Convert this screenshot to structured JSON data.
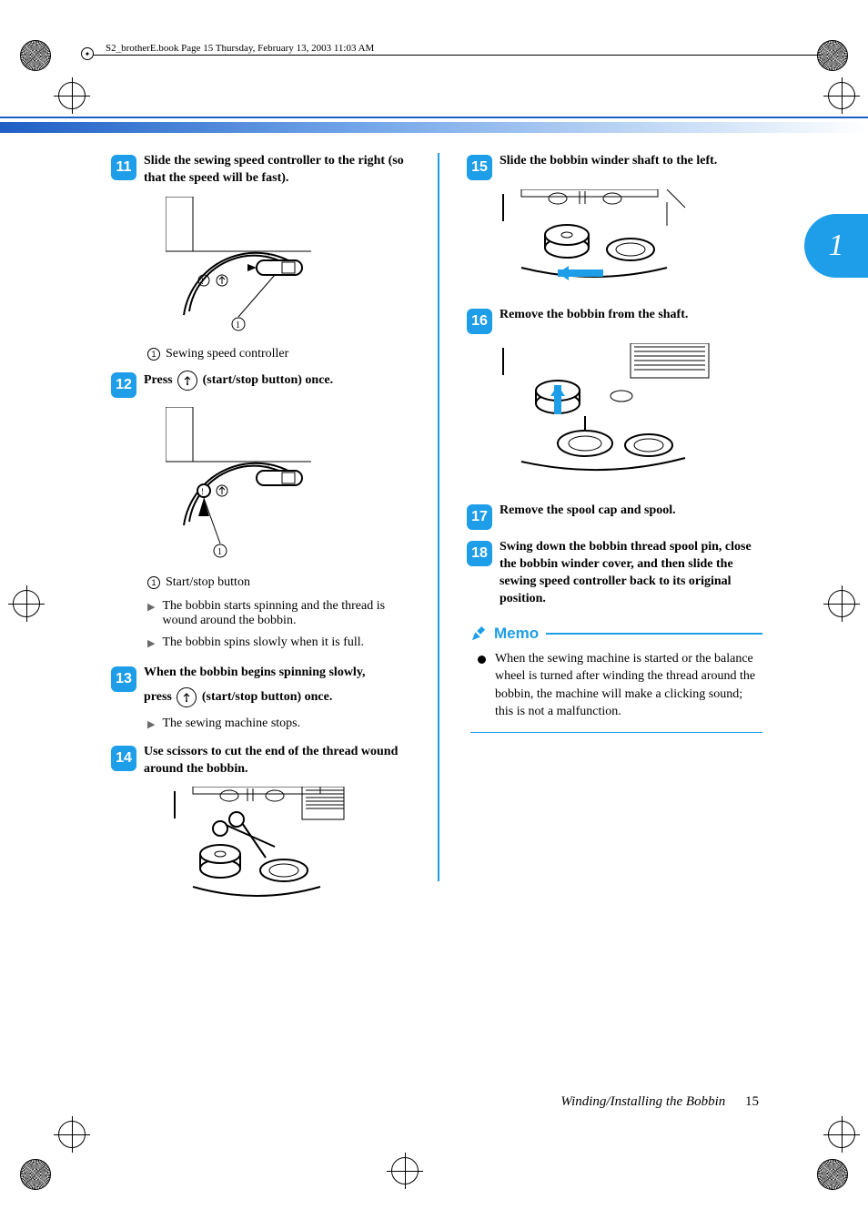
{
  "header": {
    "runner": "S2_brotherE.book  Page 15  Thursday, February 13, 2003  11:03 AM"
  },
  "chapter_tab": "1",
  "left_column": {
    "step11": {
      "num": "11",
      "text": "Slide the sewing speed controller to the right (so that the speed will be fast).",
      "callout_num": "1",
      "callout_label": "Sewing speed controller"
    },
    "step12": {
      "num": "12",
      "text_before": "Press ",
      "text_after": " (start/stop button) once.",
      "icon_glyph": "↟",
      "callout_num": "1",
      "callout_label": "Start/stop button",
      "bullet1": "The bobbin starts spinning and the thread is wound around the bobbin.",
      "bullet2": "The bobbin spins slowly when it is full."
    },
    "step13": {
      "num": "13",
      "line1": "When the bobbin begins spinning slowly,",
      "line2_before": "press ",
      "line2_after": " (start/stop button) once.",
      "icon_glyph": "↟",
      "bullet": "The sewing machine stops."
    },
    "step14": {
      "num": "14",
      "text": "Use scissors to cut the end of the thread wound around the bobbin."
    }
  },
  "right_column": {
    "step15": {
      "num": "15",
      "text": "Slide the bobbin winder shaft to the left."
    },
    "step16": {
      "num": "16",
      "text": "Remove the bobbin from the shaft."
    },
    "step17": {
      "num": "17",
      "text": "Remove the spool cap and spool."
    },
    "step18": {
      "num": "18",
      "text": "Swing down the bobbin thread spool pin, close the bobbin winder cover, and then slide the sewing speed controller back to its original position."
    },
    "memo": {
      "title": "Memo",
      "body": "When the sewing machine is started or the balance wheel is turned after winding the thread around the bobbin, the machine will make a clicking sound; this is not a malfunction."
    }
  },
  "footer": {
    "section": "Winding/Installing the Bobbin",
    "page": "15"
  }
}
